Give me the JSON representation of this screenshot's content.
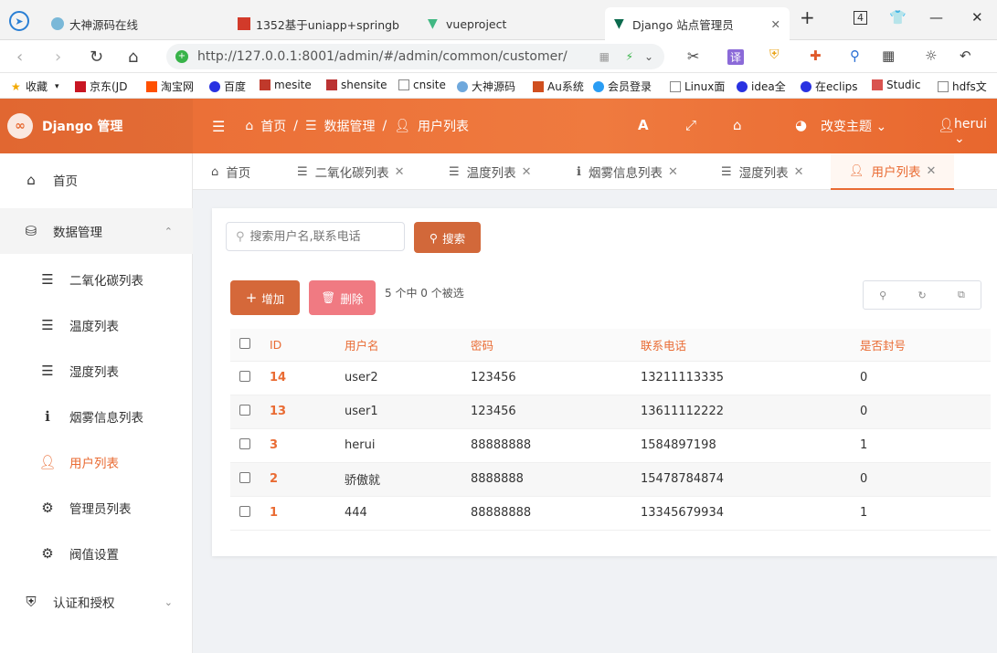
{
  "browser": {
    "tabs": [
      {
        "label": "大神源码在线"
      },
      {
        "label": "1352基于uniapp+springb"
      },
      {
        "label": "vueproject"
      },
      {
        "label": "Django 站点管理员"
      }
    ],
    "tab_count": "4",
    "url": "http://127.0.0.1:8001/admin/#/admin/common/customer/",
    "bookmarks": [
      "收藏",
      "京东(JD",
      "淘宝网",
      "百度",
      "mesite",
      "shensite",
      "cnsite",
      "大神源码",
      "Au系统",
      "会员登录",
      "Linux面",
      "idea全",
      "在eclips",
      "Studic",
      "hdfs文"
    ]
  },
  "header": {
    "app_title": "Django 管理",
    "breadcrumb": [
      "首页",
      "数据管理",
      "用户列表"
    ],
    "theme_label": "改变主题",
    "user": "herui",
    "accent": "#e96b33"
  },
  "sidebar": {
    "items": [
      {
        "label": "首页",
        "icon": "home-icon"
      },
      {
        "label": "数据管理",
        "icon": "database-icon"
      },
      {
        "label": "二氧化碳列表",
        "icon": "list-icon"
      },
      {
        "label": "温度列表",
        "icon": "list-icon"
      },
      {
        "label": "湿度列表",
        "icon": "list-icon"
      },
      {
        "label": "烟雾信息列表",
        "icon": "info-icon"
      },
      {
        "label": "用户列表",
        "icon": "user-icon"
      },
      {
        "label": "管理员列表",
        "icon": "gear-icon"
      },
      {
        "label": "阀值设置",
        "icon": "gear-icon"
      },
      {
        "label": "认证和授权",
        "icon": "shield-icon"
      }
    ]
  },
  "page_tabs": [
    {
      "label": "首页"
    },
    {
      "label": "二氧化碳列表"
    },
    {
      "label": "温度列表"
    },
    {
      "label": "烟雾信息列表"
    },
    {
      "label": "湿度列表"
    },
    {
      "label": "用户列表"
    }
  ],
  "toolbar": {
    "search_placeholder": "搜索用户名,联系电话",
    "search_label": "搜索",
    "add_label": "增加",
    "delete_label": "删除",
    "selection_status": "5 个中 0 个被选"
  },
  "table": {
    "columns": [
      "ID",
      "用户名",
      "密码",
      "联系电话",
      "是否封号"
    ],
    "rows": [
      [
        "14",
        "user2",
        "123456",
        "13211113335",
        "0"
      ],
      [
        "13",
        "user1",
        "123456",
        "13611112222",
        "0"
      ],
      [
        "3",
        "herui",
        "88888888",
        "1584897198",
        "1"
      ],
      [
        "2",
        "骄傲就",
        "8888888",
        "15478784874",
        "0"
      ],
      [
        "1",
        "444",
        "88888888",
        "13345679934",
        "1"
      ]
    ]
  }
}
